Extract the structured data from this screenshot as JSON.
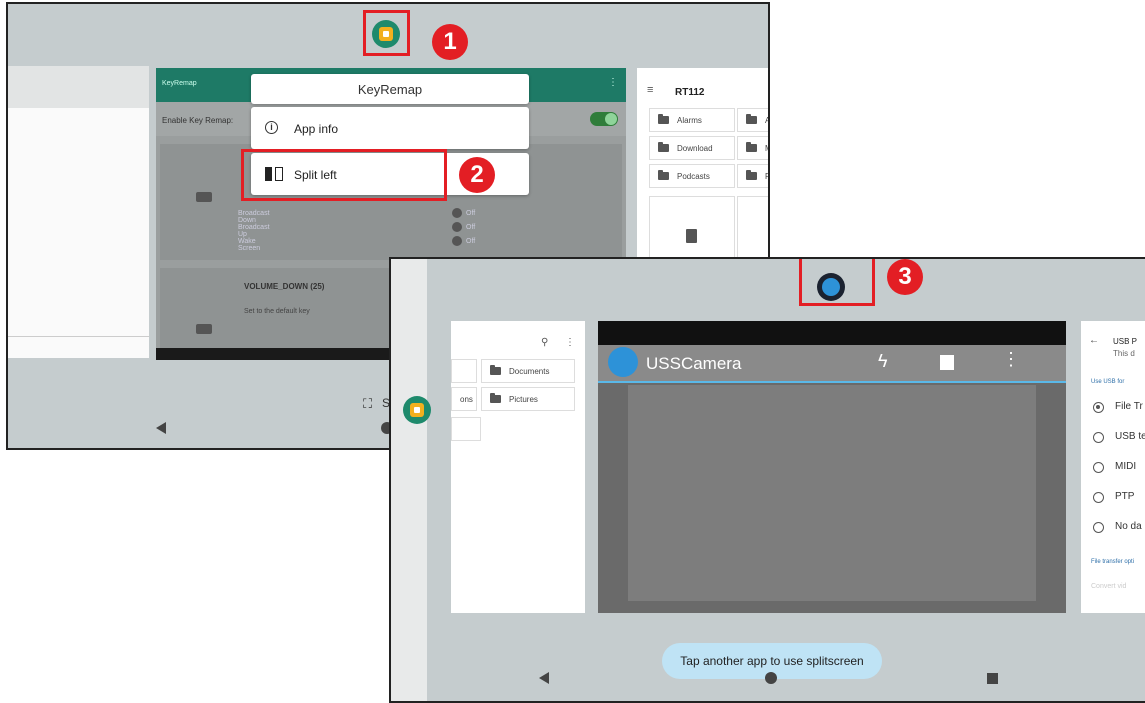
{
  "step_badges": [
    "1",
    "2",
    "3"
  ],
  "shot1": {
    "keyremap_card": {
      "header_title": "KeyRemap",
      "enable_label": "Enable Key Remap:",
      "rows": [
        {
          "label": "Broadcast Down",
          "value": "Off"
        },
        {
          "label": "Broadcast Up",
          "value": "Off"
        },
        {
          "label": "Wake Screen",
          "value": "Off"
        }
      ],
      "key_title": "VOLUME_DOWN (25)",
      "key_desc": "Set to the default key"
    },
    "popup": {
      "title": "KeyRemap",
      "items": [
        {
          "label": "App info",
          "icon": "info-icon"
        },
        {
          "label": "Split left",
          "icon": "split-left-icon"
        }
      ]
    },
    "files_card": {
      "title": "RT112",
      "folders": [
        "Alarms",
        "Download",
        "Podcasts"
      ],
      "folders_cut": [
        "A",
        "M",
        "R"
      ]
    },
    "screenshot_label": "Scre"
  },
  "shot2": {
    "files_card": {
      "folders": [
        "Documents",
        "Pictures"
      ],
      "cut_label": "ons"
    },
    "camera": {
      "app_name": "USSCamera"
    },
    "usb_card": {
      "title": "USB P",
      "top_cut": "This d",
      "section": "Use USB for",
      "options": [
        {
          "label": "File Tr",
          "selected": true
        },
        {
          "label": "USB te",
          "selected": false
        },
        {
          "label": "MIDI",
          "selected": false
        },
        {
          "label": "PTP",
          "selected": false
        },
        {
          "label": "No da",
          "selected": false
        }
      ],
      "footer": "File transfer opti",
      "footer2": "Convert vid"
    },
    "toast": "Tap another app to use splitscreen"
  },
  "colors": {
    "accent_red": "#e31e24",
    "keyremap_header": "#1e7a66",
    "toggle_on": "#43a047",
    "toast_bg": "#bfe3f5"
  }
}
